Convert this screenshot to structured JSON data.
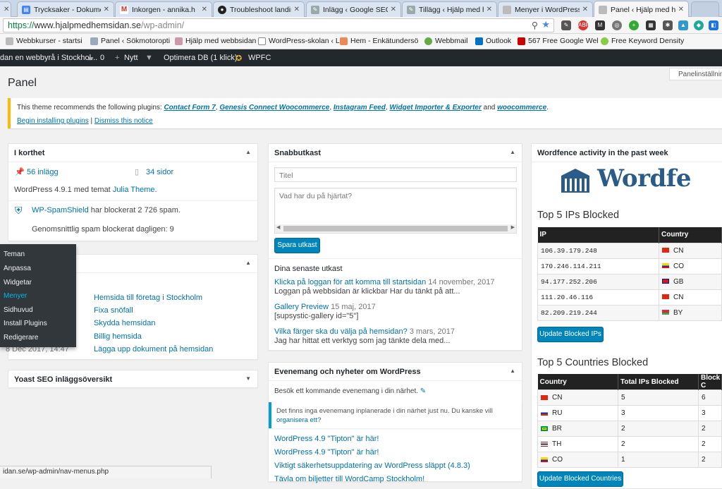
{
  "browser": {
    "tabs": [
      {
        "label": "Trycksaker - Dokume",
        "active": false
      },
      {
        "label": "Inkorgen - annika.h",
        "active": false
      },
      {
        "label": "Troubleshoot landin",
        "active": false
      },
      {
        "label": "Inlägg ‹ Google SEO",
        "active": false
      },
      {
        "label": "Tillägg ‹ Hjälp med h",
        "active": false
      },
      {
        "label": "Menyer i WordPress",
        "active": false
      },
      {
        "label": "Panel ‹ Hjälp med he",
        "active": true
      }
    ],
    "url_scheme": "https://",
    "url_host": "www.hjalpmedhemsidan.se",
    "url_path": "/wp-admin/",
    "bookmarks": [
      "Webbkurser - startsi",
      "Panel ‹ Sökmotoropti",
      "Hjälp med webbsidan",
      "WordPress-skolan ‹ L",
      "Hem - Enkätundersö",
      "Webbmail",
      "Outlook",
      "567 Free Google Wel",
      "Free Keyword Density"
    ],
    "status_url": "idan.se/wp-admin/nav-menus.php"
  },
  "adminbar": {
    "site": "dan en webbyrå i Stockhol...",
    "comments": "0",
    "new": "Nytt",
    "optimera": "Optimera DB (1 klick)",
    "wpfc": "WPFC"
  },
  "screen_options": "Panelinställning",
  "page_title": "Panel",
  "notice": {
    "prefix": "This theme recommends the following plugins: ",
    "plugins": [
      "Contact Form 7",
      "Genesis Connect Woocommerce",
      "Instagram Feed",
      "Widget Importer & Exporter",
      "woocommerce"
    ],
    "sep": ", ",
    "and": " and ",
    "end": ".",
    "begin": "Begin installing plugins",
    "pipe": " | ",
    "dismiss": "Dismiss this notice"
  },
  "glance": {
    "title": "I korthet",
    "posts": "56 inlägg",
    "pages": "34 sidor",
    "wp_text": "WordPress 4.9.1 med temat ",
    "theme": "Julia Theme",
    "dot": ".",
    "spam_link": "WP-SpamShield",
    "spam_text": " har blockerat 2 726 spam.",
    "avg": "Genomsnittlig spam blockerat dagligen: 9"
  },
  "activity": {
    "links": [
      "Hemsida till företag i Stockholm",
      "Fixa snöfall",
      "Skydda hemsidan",
      "Billig hemsida",
      "Lägga upp dokument på hemsidan"
    ],
    "date_partial": "8 Dec 2017, 14:47"
  },
  "flyout": {
    "items": [
      "Teman",
      "Anpassa",
      "Widgetar",
      "Menyer",
      "Sidhuvud",
      "Install Plugins",
      "Redigerare"
    ],
    "current": "Menyer"
  },
  "yoast": {
    "title": "Yoast SEO inläggsöversikt"
  },
  "quickdraft": {
    "title": "Snabbutkast",
    "title_placeholder": "Titel",
    "content_placeholder": "Vad har du på hjärtat?",
    "save": "Spara utkast",
    "recent_title": "Dina senaste utkast",
    "drafts": [
      {
        "link": "Klicka på loggan för att komma till startsidan",
        "date": "14 november, 2017",
        "excerpt": "Loggan på webbsidan är klickbar Har du tänkt på att..."
      },
      {
        "link": "Gallery Preview",
        "date": "15 maj, 2017",
        "excerpt": "[supsystic-gallery id=\"5\"]"
      },
      {
        "link": "Vilka färger ska du välja på hemsidan?",
        "date": "3 mars, 2017",
        "excerpt": "Jag har hittat ett verktyg som jag tänkte dela med..."
      }
    ]
  },
  "events": {
    "title": "Evenemang och nyheter om WordPress",
    "visit": "Besök ett kommande evenemang i din närhet.",
    "none": "Det finns inga evenemang inplanerade i din närhet just nu. Du kanske vill ",
    "organize": "organisera ett?",
    "news": [
      "WordPress 4.9 \"Tipton\" är här!",
      "WordPress 4.9 \"Tipton\" är här!",
      "Viktigt säkerhetsuppdatering av WordPress släppt (4.8.3)",
      "Tävla om biljetter till WordCamp Stockholm!"
    ]
  },
  "wordfence": {
    "title": "Wordfence activity in the past week",
    "logo": "Wordfe",
    "ips_title": "Top 5 IPs Blocked",
    "ip_headers": [
      "IP",
      "Country"
    ],
    "ips": [
      {
        "ip": "106.39.179.248",
        "country": "CN",
        "flag": "#de2910"
      },
      {
        "ip": "170.246.114.211",
        "country": "CO",
        "flag": "#fcd116"
      },
      {
        "ip": "94.177.252.206",
        "country": "GB",
        "flag": "#cf142b"
      },
      {
        "ip": "111.20.46.116",
        "country": "CN",
        "flag": "#de2910"
      },
      {
        "ip": "82.209.219.244",
        "country": "BY",
        "flag": "#c8313e"
      }
    ],
    "update_ips": "Update Blocked IPs",
    "countries_title": "Top 5 Countries Blocked",
    "country_headers": [
      "Country",
      "Total IPs Blocked",
      "Block C"
    ],
    "countries": [
      {
        "name": "CN",
        "total": "5",
        "block": "6",
        "flag": "#de2910"
      },
      {
        "name": "RU",
        "total": "3",
        "block": "3",
        "flag": "#0039a6"
      },
      {
        "name": "BR",
        "total": "2",
        "block": "2",
        "flag": "#009c3b"
      },
      {
        "name": "TH",
        "total": "2",
        "block": "2",
        "flag": "#2d2a4a"
      },
      {
        "name": "CO",
        "total": "1",
        "block": "2",
        "flag": "#fcd116"
      }
    ],
    "update_countries": "Update Blocked Countries"
  },
  "colors": {
    "accent": "#0073aa",
    "button": "#0085ba",
    "notice": "#ffb900",
    "adminbar": "#23282d",
    "wf_blue": "#2b5b88"
  }
}
